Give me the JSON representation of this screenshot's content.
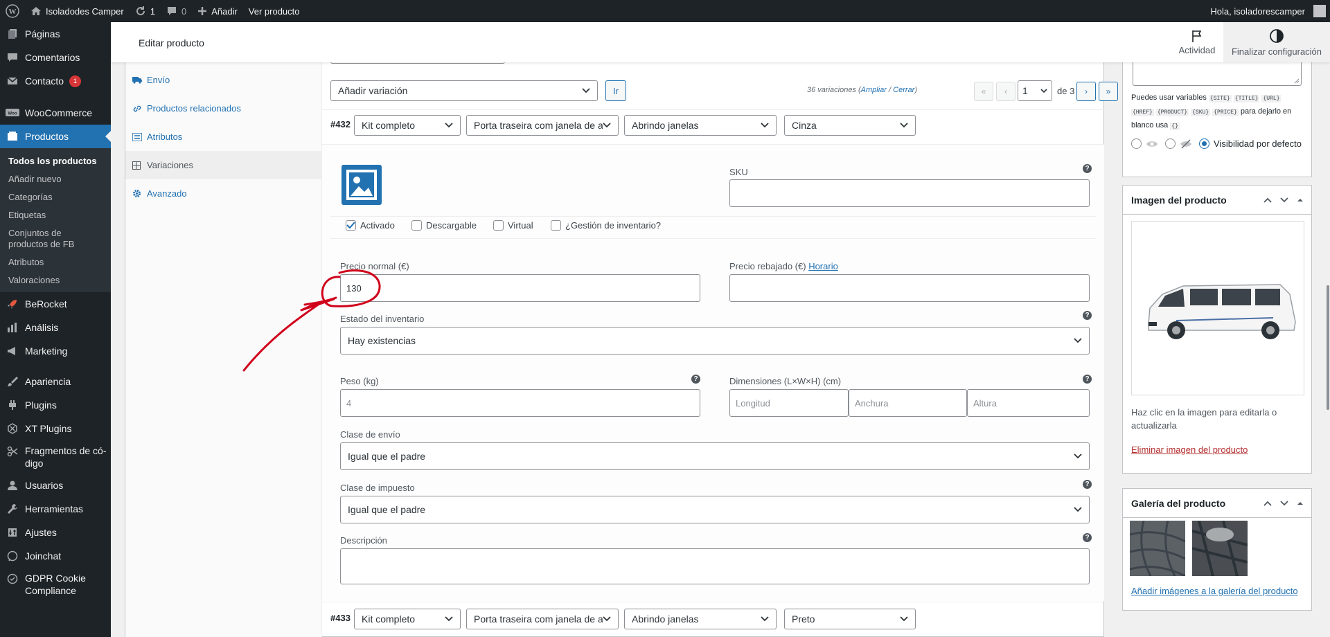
{
  "adminbar": {
    "site_name": "Isoladodes Camper",
    "updates_count": "1",
    "comments_count": "0",
    "new_label": "Añadir",
    "view_product": "Ver producto",
    "greeting": "Hola, isoladorescamper"
  },
  "sidebar": {
    "items": [
      {
        "label": "Páginas",
        "icon": "pages-icon"
      },
      {
        "label": "Comentarios",
        "icon": "comments-icon"
      },
      {
        "label": "Contacto",
        "icon": "mail-icon",
        "badge": "1"
      },
      {
        "label": "WooCommerce",
        "icon": "woocommerce-icon"
      },
      {
        "label": "Productos",
        "icon": "products-icon"
      },
      {
        "label": "BeRocket",
        "icon": "rocket-icon"
      },
      {
        "label": "Análisis",
        "icon": "analytics-icon"
      },
      {
        "label": "Marketing",
        "icon": "megaphone-icon"
      },
      {
        "label": "Apariencia",
        "icon": "brush-icon"
      },
      {
        "label": "Plugins",
        "icon": "plugin-icon"
      },
      {
        "label": "XT Plugins",
        "icon": "xt-icon"
      },
      {
        "label": "Fragmentos de có-digo",
        "icon": "scissors-icon"
      },
      {
        "label": "Usuarios",
        "icon": "users-icon"
      },
      {
        "label": "Herramientas",
        "icon": "wrench-icon"
      },
      {
        "label": "Ajustes",
        "icon": "settings-icon"
      },
      {
        "label": "Joinchat",
        "icon": "chat-icon"
      },
      {
        "label": "GDPR Cookie Compliance",
        "icon": "shield-check-icon"
      }
    ],
    "submenu": [
      "Todos los productos",
      "Añadir nuevo",
      "Categorías",
      "Etiquetas",
      "Conjuntos de productos de FB",
      "Atributos",
      "Valoraciones"
    ]
  },
  "header": {
    "title": "Editar producto",
    "activity": "Actividad",
    "finish": "Finalizar configuración"
  },
  "tabs": [
    "Envío",
    "Productos relacionados",
    "Atributos",
    "Variaciones",
    "Avanzado"
  ],
  "variations": {
    "add_select": "Añadir variación",
    "go_button": "Ir",
    "count_text": "36 variaciones",
    "expand": "Ampliar",
    "slash": "/",
    "collapse": "Cerrar",
    "page": "1",
    "of_pages": "de 3",
    "first": "«",
    "prev": "‹",
    "next": "›",
    "last": "»",
    "v1": {
      "id": "#432",
      "attrs": [
        "Kit completo",
        "Porta traseira com janela de a",
        "Abrindo janelas",
        "Cinza"
      ],
      "sku_label": "SKU",
      "sku_value": "",
      "activado": "Activado",
      "descargable": "Descargable",
      "virtual": "Virtual",
      "gestion": "¿Gestión de inventario?",
      "precio_label": "Precio normal (€)",
      "precio_value": "130",
      "rebajado_label": "Precio rebajado (€)",
      "horario": "Horario",
      "estado_label": "Estado del inventario",
      "estado_value": "Hay existencias",
      "peso_label": "Peso (kg)",
      "peso_placeholder": "4",
      "dim_label": "Dimensiones (L×W×H) (cm)",
      "longitud": "Longitud",
      "anchura": "Anchura",
      "altura": "Altura",
      "envio_label": "Clase de envío",
      "envio_value": "Igual que el padre",
      "impuesto_label": "Clase de impuesto",
      "impuesto_value": "Igual que el padre",
      "desc_label": "Descripción"
    },
    "v2": {
      "id": "#433",
      "attrs": [
        "Kit completo",
        "Porta traseira com janela de a",
        "Abrindo janelas",
        "Preto"
      ]
    }
  },
  "right": {
    "vars_pre": "Puedes usar variables",
    "vars_codes": [
      "{SITE}",
      "{TITLE}",
      "{URL}",
      "{HREF}",
      "{PRODUCT}",
      "{SKU}",
      "{PRICE}"
    ],
    "vars_post": "para dejarlo en blanco usa",
    "vars_empty": "{}",
    "visibility_default": "Visibilidad por defecto",
    "image_title": "Imagen del producto",
    "image_hint": "Haz clic en la imagen para editarla o actualizarla",
    "image_remove": "Eliminar imagen del producto",
    "gallery_title": "Galería del producto",
    "gallery_add": "Añadir imágenes a la galería del producto"
  },
  "colors": {
    "accent": "#2271b1",
    "sidebar": "#1d2327",
    "annotation": "#d0021b",
    "danger": "#b32d2e"
  }
}
